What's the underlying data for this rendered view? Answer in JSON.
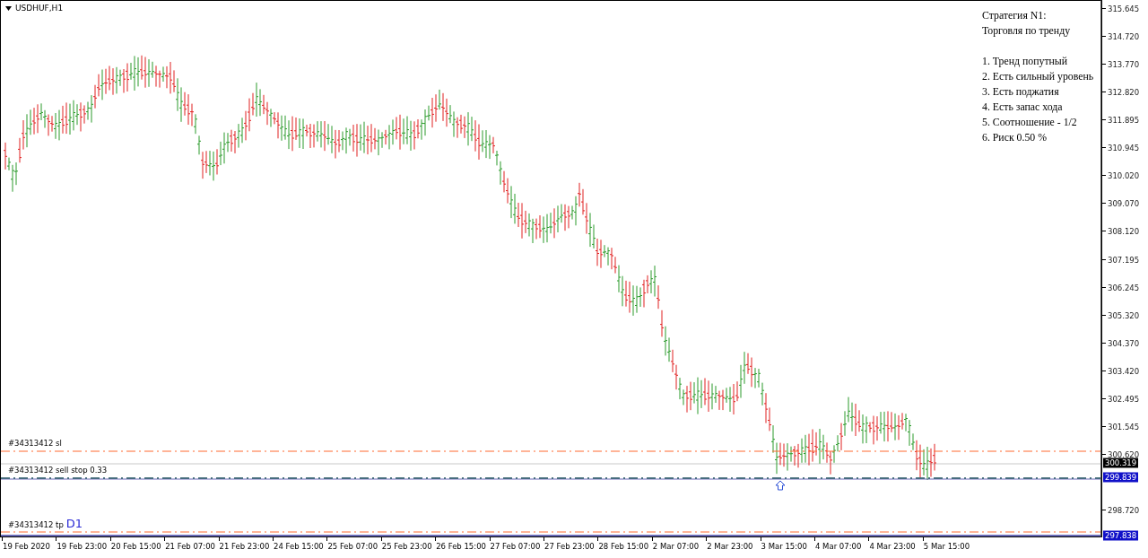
{
  "chart": {
    "symbol": "USDHUF,H1",
    "strategy": {
      "title": "Стратегия N1:",
      "subtitle": "Торговля по тренду",
      "items": [
        "1. Тренд попутный",
        "2. Есть сильный уровень",
        "3. Есть поджатия",
        "4. Есть запас хода",
        "5. Соотношение - 1/2",
        "6. Риск 0.50 %"
      ]
    },
    "order_lines": [
      {
        "kind": "sl",
        "label": "#34313412 sl"
      },
      {
        "kind": "entry",
        "label": "#34313412 sell stop 0.33"
      },
      {
        "kind": "tp",
        "label": "#34313412 tp",
        "tag": "D1"
      }
    ],
    "price_axis": {
      "ticks": [
        "315.645",
        "314.720",
        "313.770",
        "312.820",
        "311.895",
        "310.945",
        "310.020",
        "309.070",
        "308.120",
        "307.195",
        "306.245",
        "305.320",
        "304.370",
        "303.420",
        "302.495",
        "301.545",
        "300.620",
        "298.720"
      ],
      "markers": [
        {
          "kind": "bid",
          "text": "300.319"
        },
        {
          "kind": "entry",
          "text": "299.839"
        },
        {
          "kind": "tp",
          "text": "297.838"
        }
      ]
    },
    "time_axis": [
      "19 Feb 2020",
      "19 Feb 23:00",
      "20 Feb 15:00",
      "21 Feb 07:00",
      "21 Feb 23:00",
      "24 Feb 15:00",
      "25 Feb 07:00",
      "25 Feb 23:00",
      "26 Feb 15:00",
      "27 Feb 07:00",
      "27 Feb 23:00",
      "28 Feb 15:00",
      "2 Mar 07:00",
      "2 Mar 23:00",
      "3 Mar 15:00",
      "4 Mar 07:00",
      "4 Mar 23:00",
      "5 Mar 15:00"
    ]
  }
}
